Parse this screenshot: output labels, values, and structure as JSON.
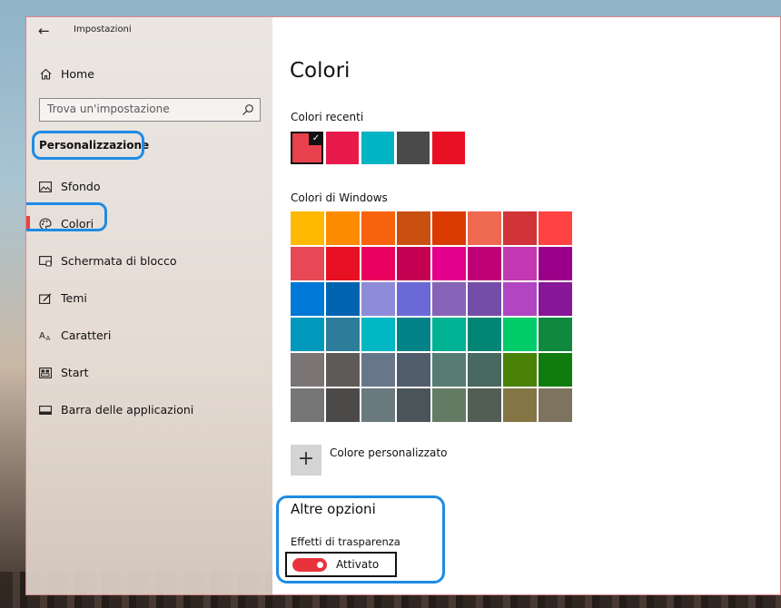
{
  "window": {
    "title": "Impostazioni"
  },
  "sidebar": {
    "home_label": "Home",
    "search_placeholder": "Trova un'impostazione",
    "section_title": "Personalizzazione",
    "items": [
      {
        "label": "Sfondo",
        "icon": "image-icon",
        "selected": false
      },
      {
        "label": "Colori",
        "icon": "palette-icon",
        "selected": true
      },
      {
        "label": "Schermata di blocco",
        "icon": "lock-screen-icon",
        "selected": false
      },
      {
        "label": "Temi",
        "icon": "themes-icon",
        "selected": false
      },
      {
        "label": "Caratteri",
        "icon": "fonts-icon",
        "selected": false
      },
      {
        "label": "Start",
        "icon": "start-icon",
        "selected": false
      },
      {
        "label": "Barra delle applicazioni",
        "icon": "taskbar-icon",
        "selected": false
      }
    ]
  },
  "main": {
    "title": "Colori",
    "recent_label": "Colori recenti",
    "recent_colors": [
      "#e8404c",
      "#e81a4b",
      "#00b4c4",
      "#4a4a4a",
      "#e81123"
    ],
    "recent_selected": 0,
    "windows_label": "Colori di Windows",
    "windows_colors": [
      "#ffb900",
      "#ff8c00",
      "#f7630c",
      "#ca5010",
      "#da3b01",
      "#ef6950",
      "#d13438",
      "#ff4343",
      "#e74856",
      "#e81123",
      "#ea005e",
      "#c30052",
      "#e3008c",
      "#bf0077",
      "#c239b3",
      "#9a0089",
      "#0078d7",
      "#0063b1",
      "#8e8cd8",
      "#6b69d6",
      "#8764b8",
      "#744da9",
      "#b146c2",
      "#881798",
      "#0099bc",
      "#2d7d9a",
      "#00b7c3",
      "#038387",
      "#00b294",
      "#018574",
      "#00cc6a",
      "#10893e",
      "#7a7574",
      "#5d5a58",
      "#68768a",
      "#515c6b",
      "#567c73",
      "#486860",
      "#498205",
      "#107c10",
      "#767676",
      "#4c4a48",
      "#69797e",
      "#4a5459",
      "#647c64",
      "#525e54",
      "#847545",
      "#7e735f"
    ],
    "custom_label": "Colore personalizzato",
    "more_title": "Altre opzioni",
    "transparency_label": "Effetti di trasparenza",
    "transparency_state": "Attivato",
    "accent_color": "#e8333d",
    "highlight_color": "#1e8be5"
  }
}
